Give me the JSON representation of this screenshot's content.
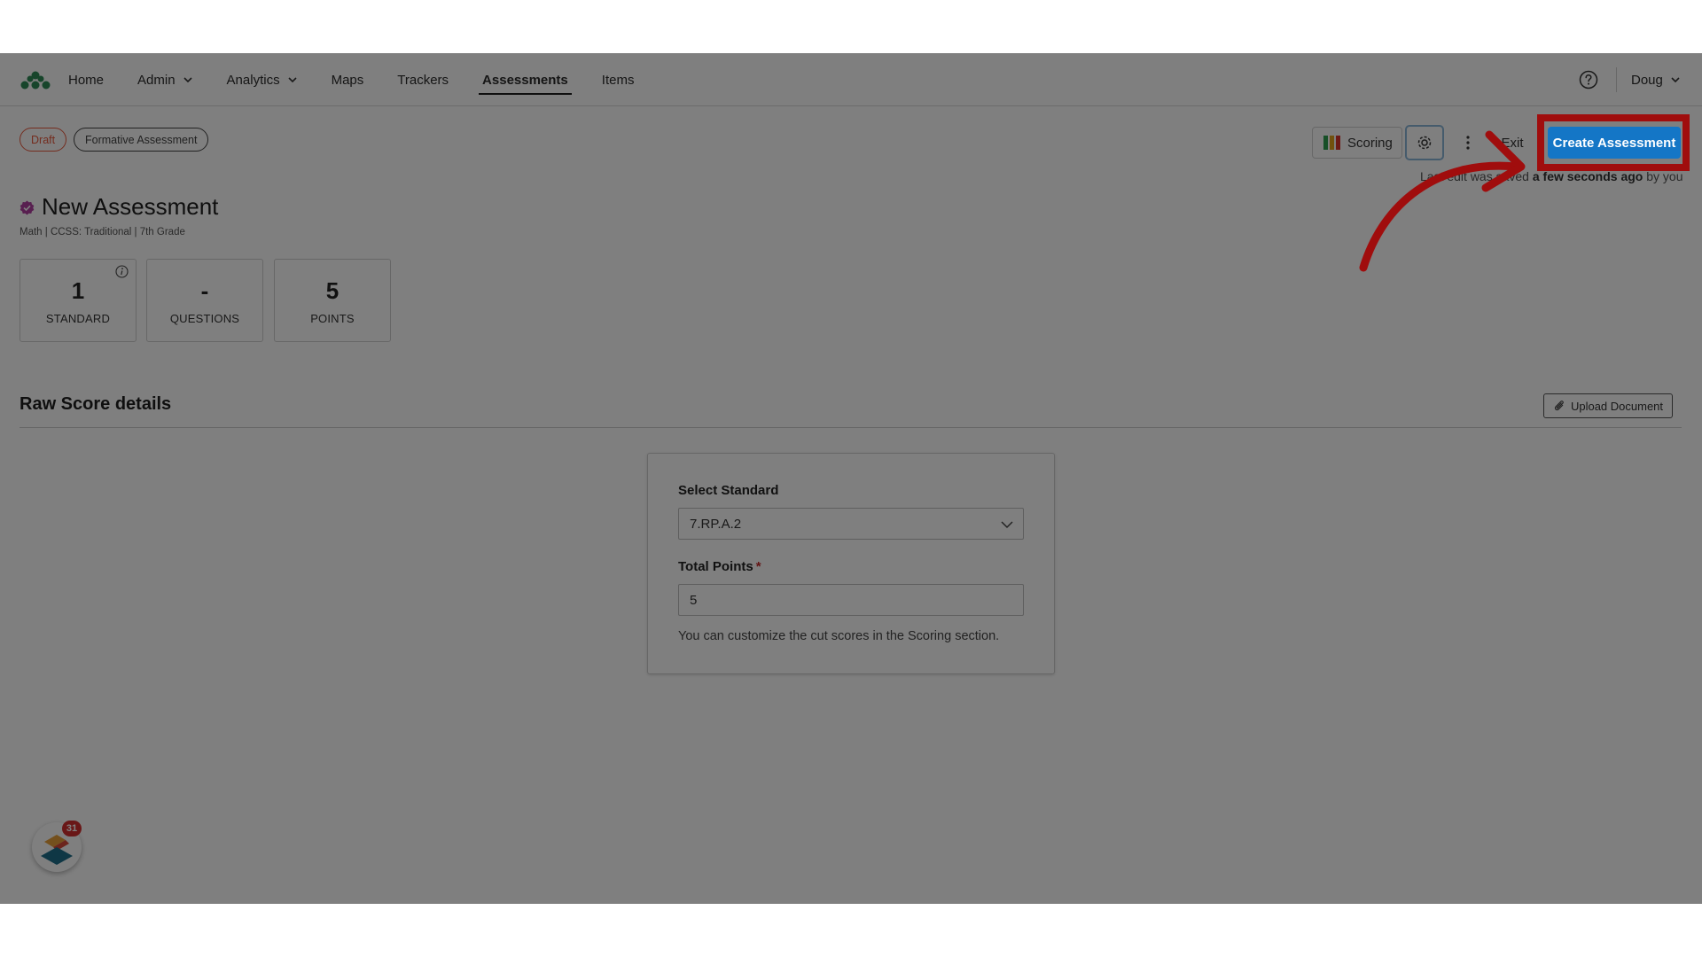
{
  "nav": {
    "items": [
      {
        "label": "Home",
        "dropdown": false,
        "active": false
      },
      {
        "label": "Admin",
        "dropdown": true,
        "active": false
      },
      {
        "label": "Analytics",
        "dropdown": true,
        "active": false
      },
      {
        "label": "Maps",
        "dropdown": false,
        "active": false
      },
      {
        "label": "Trackers",
        "dropdown": false,
        "active": false
      },
      {
        "label": "Assessments",
        "dropdown": false,
        "active": true
      },
      {
        "label": "Items",
        "dropdown": false,
        "active": false
      }
    ],
    "user": "Doug",
    "help_icon": "question-circle-icon"
  },
  "badges": {
    "status": "Draft",
    "type": "Formative Assessment"
  },
  "toolbar": {
    "scoring_label": "Scoring",
    "exit_label": "Exit",
    "create_label": "Create Assessment",
    "last_edit_prefix": "Last edit was saved ",
    "last_edit_time": "a few seconds ago",
    "last_edit_suffix": " by you"
  },
  "assessment": {
    "title": "New Assessment",
    "subtitle": "Math  |  CCSS: Traditional  |  7th Grade"
  },
  "stats": [
    {
      "value": "1",
      "label": "STANDARD"
    },
    {
      "value": "-",
      "label": "QUESTIONS"
    },
    {
      "value": "5",
      "label": "POINTS"
    }
  ],
  "section": {
    "title": "Raw Score details",
    "upload_label": "Upload Document"
  },
  "form": {
    "standard_label": "Select Standard",
    "standard_value": "7.RP.A.2",
    "points_label": "Total Points",
    "points_required_mark": "*",
    "points_value": "5",
    "help_text": "You can customize the cut scores in the Scoring section."
  },
  "widget": {
    "badge_count": "31"
  },
  "colors": {
    "accent": "#1476c6",
    "draft": "#e8593d",
    "highlight": "#a00d0d",
    "logo": "#2e8b57"
  }
}
